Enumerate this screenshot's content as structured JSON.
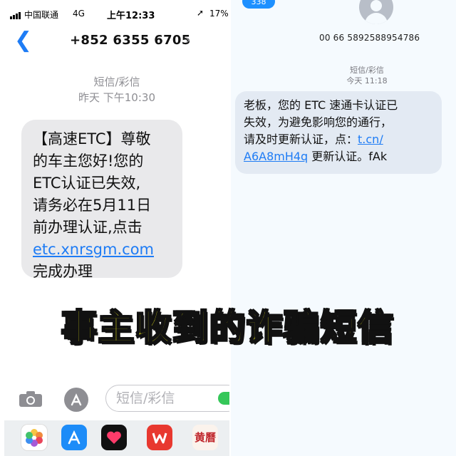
{
  "left_phone": {
    "status_bar": {
      "carrier": "中国联通",
      "network": "4G",
      "time": "上午12:33",
      "battery": "17%"
    },
    "header": {
      "phone_number": "+852 6355 6705"
    },
    "message_type": "短信/彩信",
    "timestamp": "昨天 下午10:30",
    "message": {
      "lines": [
        "【高速ETC】尊敬",
        "的车主您好!您的",
        "ETC认证已失效,",
        "请务必在5月11日",
        "前办理认证,点击"
      ],
      "link": "etc.xnrsgm.com",
      "tail": "完成办理"
    },
    "input": {
      "placeholder": "短信/彩信"
    },
    "app_drawer": [
      {
        "icon": "photos-app-icon",
        "color": "#ffffff"
      },
      {
        "icon": "app-store-icon",
        "color": "#1d8cf8"
      },
      {
        "icon": "digital-touch-icon",
        "color": "#111111"
      },
      {
        "icon": "wps-office-icon",
        "color": "#e8382f"
      },
      {
        "icon": "calendar-app-icon",
        "color": "#c0282d",
        "text": "黄曆"
      }
    ]
  },
  "right_phone": {
    "badge": "338",
    "sender_number": "00 66 5892588954786",
    "message_type": "短信/彩信",
    "timestamp": "今天 11:18",
    "message": {
      "lines": [
        "老板，您的 ETC 速通卡认证已",
        "失效，为避免影响您的通行，",
        "请及时更新认证，点："
      ],
      "link_part1": "t.cn/",
      "link_part2": "A6A8mH4q",
      "tail": " 更新认证。fAk"
    }
  },
  "caption": "事主收到的诈骗短信"
}
